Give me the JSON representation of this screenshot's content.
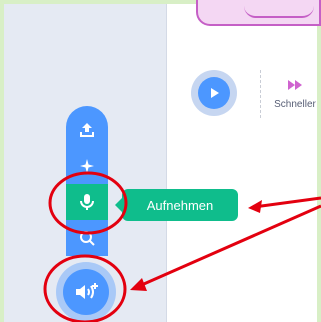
{
  "controls": {
    "speed_label": "Schneller"
  },
  "sound_menu": {
    "items": [
      {
        "icon": "upload-icon"
      },
      {
        "icon": "surprise-sparkle-icon"
      },
      {
        "icon": "microphone-icon"
      },
      {
        "icon": "search-icon"
      }
    ],
    "active_item": "microphone-icon",
    "tooltip_label": "Aufnehmen",
    "main_button_icon": "add-sound-icon"
  },
  "annotations": {
    "highlight_color": "#e3000f",
    "shapes": [
      "circle",
      "circle",
      "arrow",
      "arrow"
    ]
  },
  "colors": {
    "scratch_blue": "#4c97ff",
    "scratch_green": "#0fbd8c",
    "sprite_pink": "#c55fc6"
  }
}
